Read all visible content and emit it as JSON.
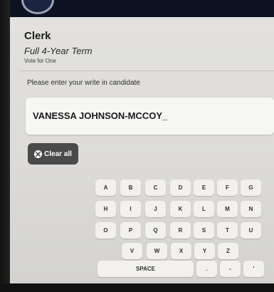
{
  "contest": {
    "office": "Clerk",
    "term": "Full 4-Year Term",
    "vote_for": "Vote for One"
  },
  "writein": {
    "prompt": "Please enter your write in candidate",
    "value": "VANESSA JOHNSON-MCCOY_"
  },
  "clear_button": {
    "label": "Clear all",
    "icon": "close-circle-icon"
  },
  "keyboard": {
    "row1": [
      "A",
      "B",
      "C",
      "D",
      "E",
      "F",
      "G"
    ],
    "row2": [
      "H",
      "I",
      "J",
      "K",
      "L",
      "M",
      "N"
    ],
    "row3": [
      "O",
      "P",
      "Q",
      "R",
      "S",
      "T",
      "U"
    ],
    "row4": [
      "V",
      "W",
      "X",
      "Y",
      "Z"
    ],
    "row5": [
      "SPACE",
      ".",
      "-",
      "'"
    ]
  },
  "colors": {
    "screen_background": "#e1e0dd",
    "key_background": "#f2f1ee",
    "clear_button_background": "#4a4a4a",
    "bezel": "#0c1220"
  }
}
